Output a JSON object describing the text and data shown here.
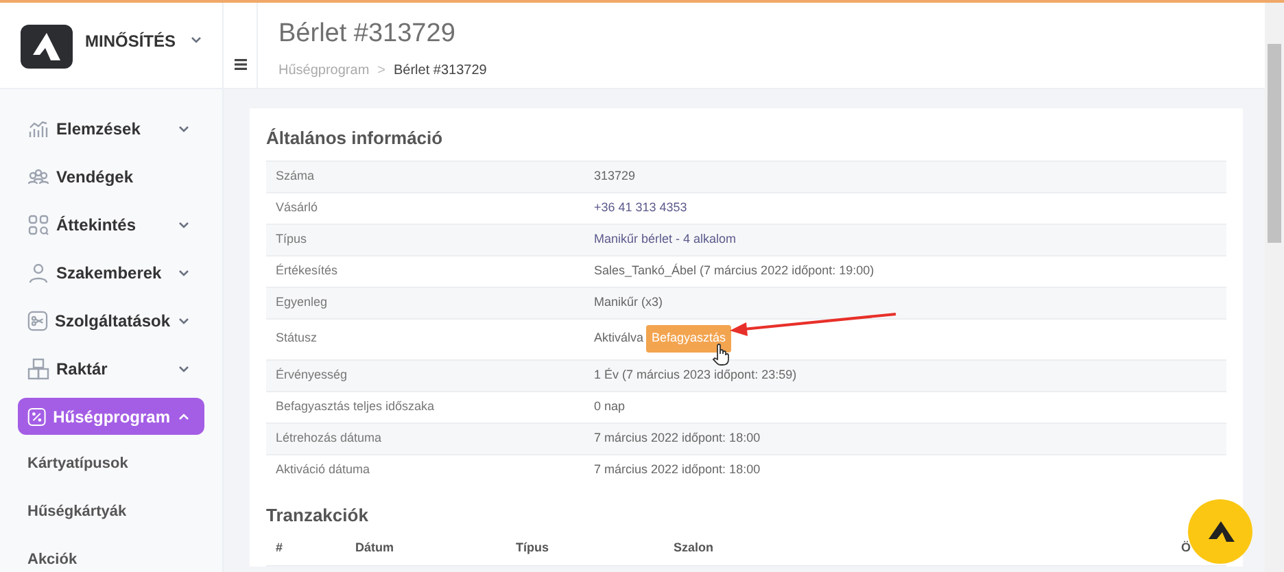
{
  "brand": {
    "name": "MINŐSÍTÉS"
  },
  "page": {
    "title": "Bérlet #313729",
    "separator": ">",
    "breadcrumb": [
      {
        "label": "Hűségprogram",
        "current": false
      },
      {
        "label": "Bérlet #313729",
        "current": true
      }
    ]
  },
  "sidebar": {
    "items": [
      {
        "label": "Elemzések",
        "kind": "chart",
        "expanded": false,
        "selected": false
      },
      {
        "label": "Vendégek",
        "kind": "users",
        "selected": false
      },
      {
        "label": "Áttekintés",
        "kind": "grid",
        "expanded": false,
        "selected": false
      },
      {
        "label": "Szakemberek",
        "kind": "user",
        "expanded": false,
        "selected": false
      },
      {
        "label": "Szolgáltatások",
        "kind": "scissors",
        "expanded": false,
        "selected": false
      },
      {
        "label": "Raktár",
        "kind": "boxes",
        "expanded": false,
        "selected": false
      },
      {
        "label": "Hűségprogram",
        "kind": "percent",
        "expanded": true,
        "selected": true,
        "children": [
          {
            "label": "Kártyatípusok"
          },
          {
            "label": "Hűségkártyák"
          },
          {
            "label": "Akciók"
          }
        ]
      }
    ]
  },
  "general_info": {
    "title": "Általános információ",
    "rows": [
      {
        "label": "Száma",
        "value": "313729",
        "link": false
      },
      {
        "label": "Vásárló",
        "value": "+36 41 313 4353",
        "link": true
      },
      {
        "label": "Típus",
        "value": "Manikűr bérlet - 4 alkalom",
        "link": true
      },
      {
        "label": "Értékesítés",
        "value": "Sales_Tankó_Ábel (7 március 2022 időpont: 19:00)",
        "link": false
      },
      {
        "label": "Egyenleg",
        "value": "Manikűr (x3)",
        "link": false
      },
      {
        "label": "Státusz",
        "value": "Aktiválva",
        "link": false,
        "action": "Befagyasztás"
      },
      {
        "label": "Érvényesség",
        "value": "1 Év (7 március 2023 időpont: 23:59)",
        "link": false
      },
      {
        "label": "Befagyasztás teljes időszaka",
        "value": "0 nap",
        "link": false
      },
      {
        "label": "Létrehozás dátuma",
        "value": "7 március 2022 időpont: 18:00",
        "link": false
      },
      {
        "label": "Aktiváció dátuma",
        "value": "7 március 2022 időpont: 18:00",
        "link": false
      }
    ]
  },
  "transactions": {
    "title": "Tranzakciók",
    "columns": [
      "#",
      "Dátum",
      "Típus",
      "Szalon",
      "Ö"
    ]
  }
}
